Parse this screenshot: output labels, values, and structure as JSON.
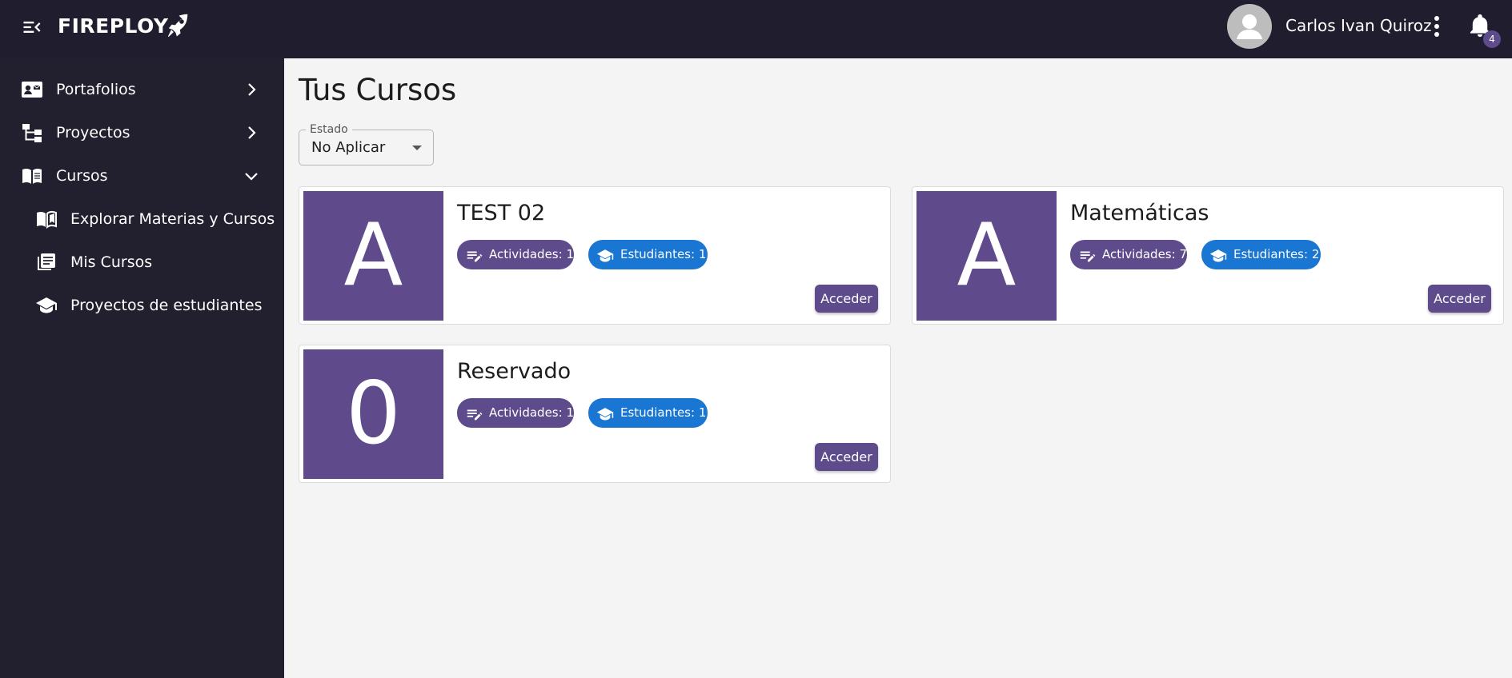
{
  "header": {
    "brand": "FIREPLOY",
    "user_name": "Carlos Ivan Quiroz",
    "notification_count": "4"
  },
  "sidebar": {
    "items": [
      {
        "label": "Portafolios",
        "icon": "contact-card-icon",
        "expanded": false
      },
      {
        "label": "Proyectos",
        "icon": "hierarchy-icon",
        "expanded": false
      },
      {
        "label": "Cursos",
        "icon": "open-book-icon",
        "expanded": true
      }
    ],
    "sub_items": [
      {
        "label": "Explorar Materias y Cursos",
        "icon": "book-explore-icon"
      },
      {
        "label": "Mis Cursos",
        "icon": "library-books-icon"
      },
      {
        "label": "Proyectos de estudiantes",
        "icon": "graduation-cap-icon"
      }
    ]
  },
  "main": {
    "title": "Tus Cursos",
    "filter": {
      "legend": "Estado",
      "value": "No Aplicar"
    },
    "courses": [
      {
        "letter": "A",
        "title": "TEST 02",
        "activities": "Actividades: 1",
        "students": "Estudiantes: 1",
        "button": "Acceder"
      },
      {
        "letter": "A",
        "title": "Matemáticas",
        "activities": "Actividades: 7",
        "students": "Estudiantes: 2",
        "button": "Acceder"
      },
      {
        "letter": "0",
        "title": "Reservado",
        "activities": "Actividades: 1",
        "students": "Estudiantes: 1",
        "button": "Acceder"
      }
    ]
  },
  "colors": {
    "topbar": "#1f1d2e",
    "sidebar": "#22202f",
    "accent_purple": "#5e4b8b",
    "accent_blue": "#1976d2",
    "background": "#f4f4f4"
  }
}
